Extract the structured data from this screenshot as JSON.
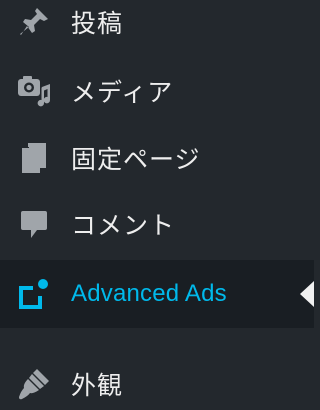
{
  "colors": {
    "background": "#23282d",
    "active_background": "#191e23",
    "text": "#eeeeee",
    "icon": "#a0a5aa",
    "accent": "#00b9eb",
    "pointer": "#f1f1f1"
  },
  "menu": {
    "items": [
      {
        "label": "投稿",
        "icon": "pin-icon",
        "active": false
      },
      {
        "label": "メディア",
        "icon": "media-icon",
        "active": false
      },
      {
        "label": "固定ページ",
        "icon": "pages-icon",
        "active": false
      },
      {
        "label": "コメント",
        "icon": "comment-icon",
        "active": false
      },
      {
        "label": "Advanced Ads",
        "icon": "advanced-ads-icon",
        "active": true
      },
      {
        "label": "外観",
        "icon": "appearance-brush-icon",
        "active": false
      }
    ]
  }
}
